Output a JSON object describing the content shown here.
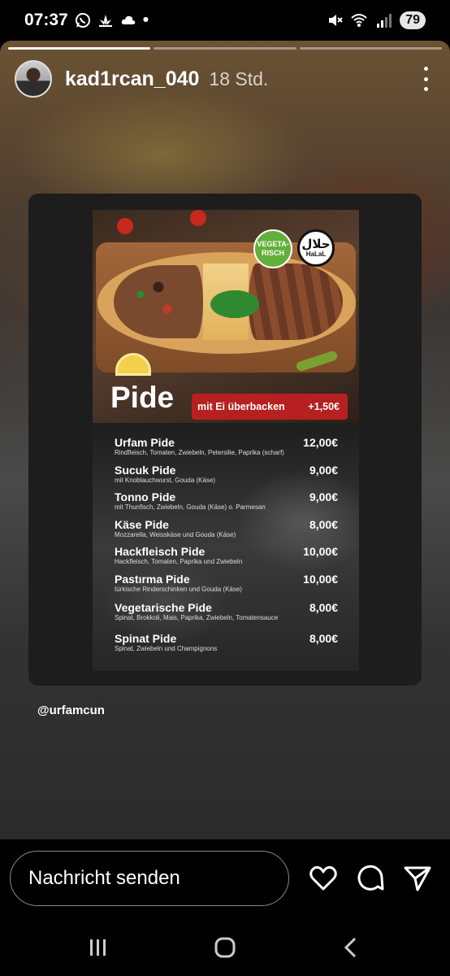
{
  "status_bar": {
    "time": "07:37",
    "dot": "•",
    "battery": "79",
    "left_icons": [
      "whatsapp-icon",
      "lotus-icon",
      "cloud-icon"
    ],
    "right_icons": [
      "mute-icon",
      "wifi-icon",
      "signal-icon"
    ]
  },
  "story": {
    "progress_segments": 3,
    "progress_done": 1,
    "username": "kad1rcan_040",
    "time_ago": "18 Std.",
    "mention": "@urfamcun"
  },
  "menu": {
    "title": "Pide",
    "egg_option": "mit Ei überbacken",
    "egg_price": "+1,50€",
    "badge_veg": "VEGETA-\nRISCH",
    "badge_halal_glyph": "حلال",
    "badge_halal_text": "HaLaL",
    "items": [
      {
        "name": "Urfam Pide",
        "price": "12,00€",
        "desc": "Rindfleisch, Tomaten, Zwiebeln, Petersilie, Paprika (scharf)"
      },
      {
        "name": "Sucuk Pide",
        "price": "9,00€",
        "desc": "mit Knoblauchwurst, Gouda (Käse)"
      },
      {
        "name": "Tonno Pide",
        "price": "9,00€",
        "desc": "mit Thunfisch, Zwiebeln, Gouda (Käse) o. Parmesan"
      },
      {
        "name": "Käse Pide",
        "price": "8,00€",
        "desc": "Mozzarella, Weisskäse und Gouda (Käse)"
      },
      {
        "name": "Hackfleisch Pide",
        "price": "10,00€",
        "desc": "Hackfleisch, Tomaten, Paprika und Zwiebeln"
      },
      {
        "name": "Pastırma Pide",
        "price": "10,00€",
        "desc": "türkische Rinderschinken und Gouda (Käse)"
      },
      {
        "name": "Vegetarische Pide",
        "price": "8,00€",
        "desc": "Spinat, Brokkoli, Mais, Paprika, Zwiebeln, Tomatensauce"
      },
      {
        "name": "Spinat Pide",
        "price": "8,00€",
        "desc": "Spinat, Zwiebeln und Champignons"
      }
    ]
  },
  "reply": {
    "placeholder": "Nachricht senden",
    "actions": [
      "heart-icon",
      "comment-icon",
      "send-icon"
    ]
  },
  "nav": {
    "buttons": [
      "recent-apps-icon",
      "home-icon",
      "back-icon"
    ]
  }
}
